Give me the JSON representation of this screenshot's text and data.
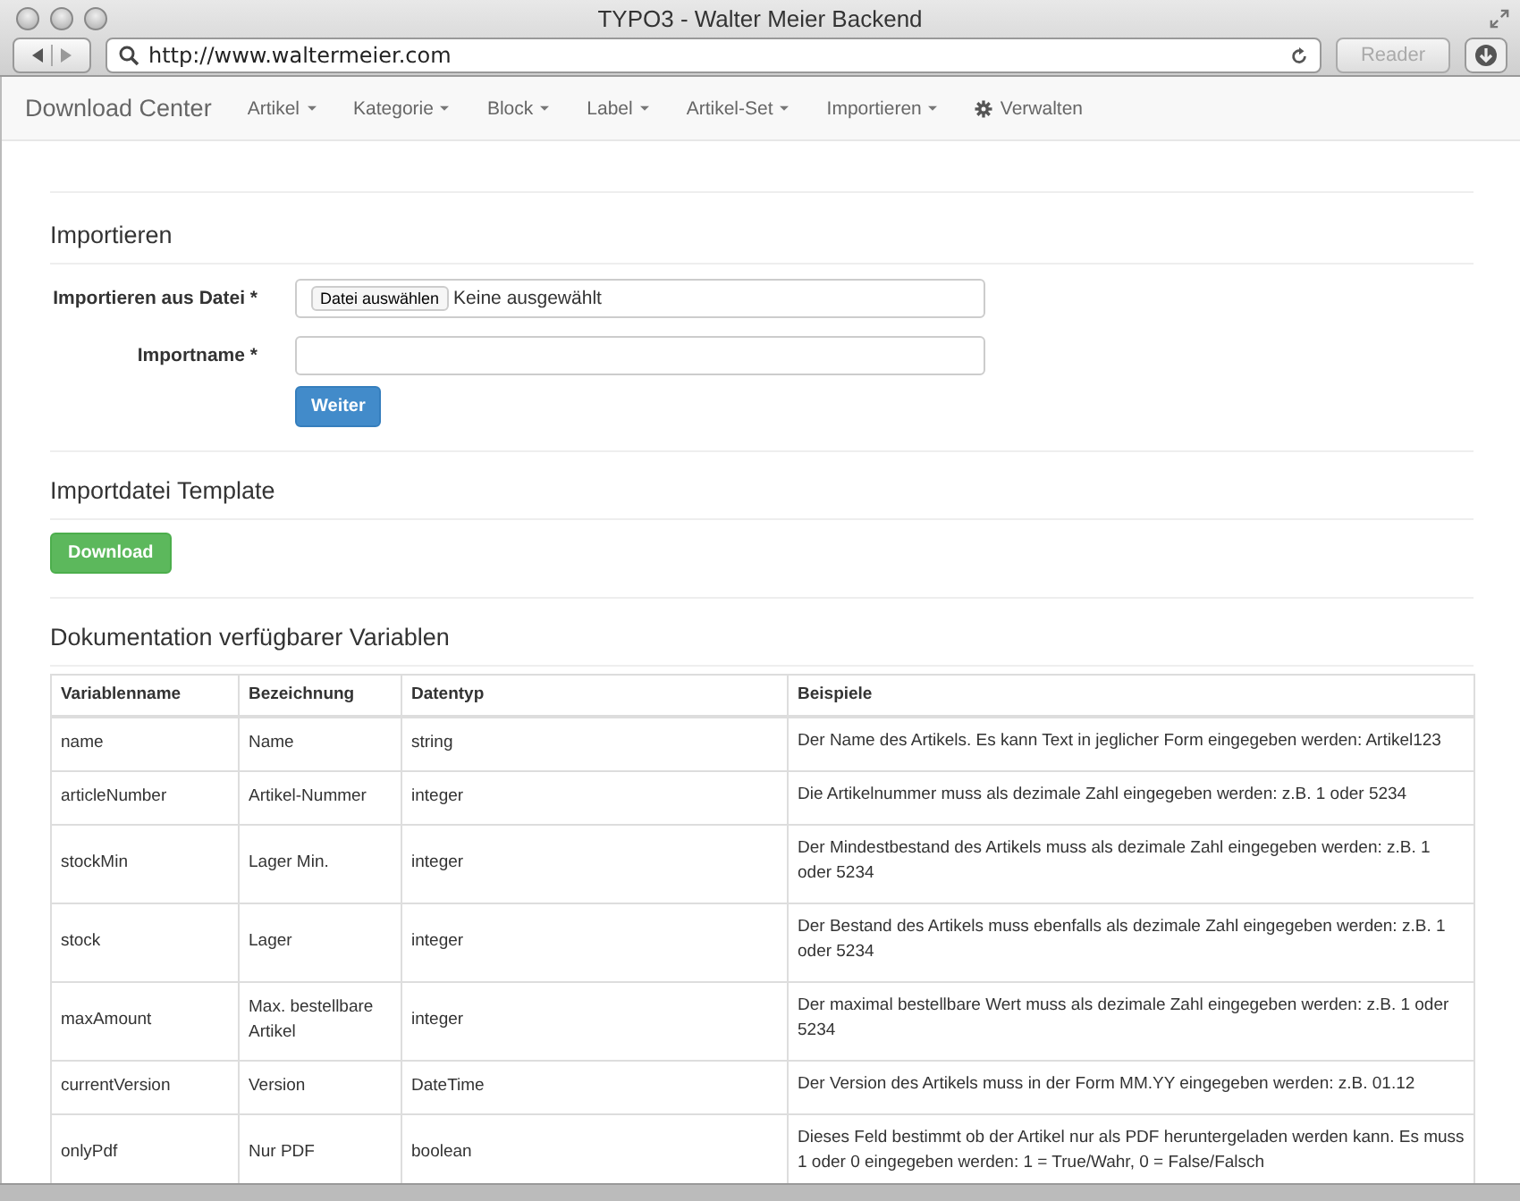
{
  "window": {
    "title": "TYPO3 - Walter Meier Backend"
  },
  "browser": {
    "url": "http://www.waltermeier.com",
    "reader_button": "Reader"
  },
  "navbar": {
    "brand": "Download Center",
    "items": [
      {
        "label": "Artikel",
        "kind": "dropdown"
      },
      {
        "label": "Kategorie",
        "kind": "dropdown"
      },
      {
        "label": "Block",
        "kind": "dropdown"
      },
      {
        "label": "Label",
        "kind": "dropdown"
      },
      {
        "label": "Artikel-Set",
        "kind": "dropdown"
      },
      {
        "label": "Importieren",
        "kind": "dropdown"
      },
      {
        "label": "Verwalten",
        "kind": "settings"
      }
    ]
  },
  "import_form": {
    "heading": "Importieren",
    "file_label": "Importieren aus Datei *",
    "file_button": "Datei auswählen",
    "file_status": "Keine ausgewählt",
    "name_label": "Importname *",
    "submit": "Weiter"
  },
  "template": {
    "heading": "Importdatei Template",
    "button": "Download"
  },
  "docs": {
    "heading": "Dokumentation verfügbarer Variablen",
    "columns": [
      "Variablenname",
      "Bezeichnung",
      "Datentyp",
      "Beispiele"
    ],
    "rows": [
      [
        "name",
        "Name",
        "string",
        "Der Name des Artikels. Es kann Text in jeglicher Form eingegeben werden: Artikel123"
      ],
      [
        "articleNumber",
        "Artikel-Nummer",
        "integer",
        "Die Artikelnummer muss als dezimale Zahl eingegeben werden: z.B. 1 oder 5234"
      ],
      [
        "stockMin",
        "Lager Min.",
        "integer",
        "Der Mindestbestand des Artikels muss als dezimale Zahl eingegeben werden: z.B. 1 oder 5234"
      ],
      [
        "stock",
        "Lager",
        "integer",
        "Der Bestand des Artikels muss ebenfalls als dezimale Zahl eingegeben werden: z.B. 1 oder 5234"
      ],
      [
        "maxAmount",
        "Max. bestellbare Artikel",
        "integer",
        "Der maximal bestellbare Wert muss als dezimale Zahl eingegeben werden: z.B. 1 oder 5234"
      ],
      [
        "currentVersion",
        "Version",
        "DateTime",
        "Der Version des Artikels muss in der Form MM.YY eingegeben werden: z.B. 01.12"
      ],
      [
        "onlyPdf",
        "Nur PDF",
        "boolean",
        "Dieses Feld bestimmt ob der Artikel nur als PDF heruntergeladen werden kann. Es muss 1 oder 0 eingegeben werden: 1 = True/Wahr, 0 = False/Falsch"
      ]
    ]
  }
}
